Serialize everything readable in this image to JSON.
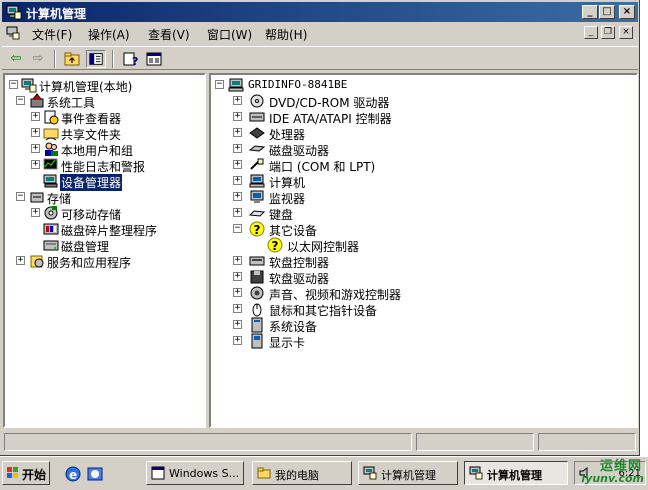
{
  "window": {
    "title": "计算机管理"
  },
  "menu": {
    "items": [
      {
        "label": "文件(F)"
      },
      {
        "label": "操作(A)"
      },
      {
        "label": "查看(V)"
      },
      {
        "label": "窗口(W)"
      },
      {
        "label": "帮助(H)"
      }
    ]
  },
  "left_tree": [
    {
      "label": "计算机管理(本地)",
      "expanded": true,
      "icon": "computer-management-icon"
    },
    {
      "label": "系统工具",
      "expanded": true,
      "icon": "system-tools-icon"
    },
    {
      "label": "事件查看器",
      "expanded": false,
      "icon": "event-viewer-icon"
    },
    {
      "label": "共享文件夹",
      "expanded": false,
      "icon": "shared-folder-icon"
    },
    {
      "label": "本地用户和组",
      "expanded": false,
      "icon": "users-icon"
    },
    {
      "label": "性能日志和警报",
      "expanded": false,
      "icon": "performance-icon"
    },
    {
      "label": "设备管理器",
      "selected": true,
      "icon": "device-manager-icon"
    },
    {
      "label": "存储",
      "expanded": true,
      "icon": "storage-icon"
    },
    {
      "label": "可移动存储",
      "expanded": false,
      "icon": "removable-storage-icon"
    },
    {
      "label": "磁盘碎片整理程序",
      "icon": "defrag-icon"
    },
    {
      "label": "磁盘管理",
      "icon": "disk-management-icon"
    },
    {
      "label": "服务和应用程序",
      "expanded": false,
      "icon": "services-icon"
    }
  ],
  "right_tree": {
    "root": "GRIDINFO-8841BE",
    "items": [
      {
        "label": "DVD/CD-ROM 驱动器",
        "icon": "dvd-icon"
      },
      {
        "label": "IDE ATA/ATAPI 控制器",
        "icon": "ide-controller-icon"
      },
      {
        "label": "处理器",
        "icon": "processor-icon"
      },
      {
        "label": "磁盘驱动器",
        "icon": "disk-drive-icon"
      },
      {
        "label": "端口 (COM 和 LPT)",
        "icon": "port-icon"
      },
      {
        "label": "计算机",
        "icon": "computer-icon"
      },
      {
        "label": "监视器",
        "icon": "monitor-icon"
      },
      {
        "label": "键盘",
        "icon": "keyboard-icon"
      },
      {
        "label": "其它设备",
        "icon": "unknown-device-icon",
        "expanded": true
      },
      {
        "label": "以太网控制器",
        "icon": "unknown-device-icon",
        "child": true
      },
      {
        "label": "软盘控制器",
        "icon": "floppy-controller-icon"
      },
      {
        "label": "软盘驱动器",
        "icon": "floppy-drive-icon"
      },
      {
        "label": "声音、视频和游戏控制器",
        "icon": "sound-icon"
      },
      {
        "label": "鼠标和其它指针设备",
        "icon": "mouse-icon"
      },
      {
        "label": "系统设备",
        "icon": "system-device-icon"
      },
      {
        "label": "显示卡",
        "icon": "display-adapter-icon"
      }
    ]
  },
  "taskbar": {
    "start": "开始",
    "buttons": [
      {
        "label": "Windows S..."
      },
      {
        "label": "我的电脑"
      },
      {
        "label": "计算机管理"
      },
      {
        "label": "计算机管理",
        "active": true
      }
    ],
    "clock": "6:21"
  },
  "watermark": {
    "line1": "运维网",
    "line2": "iyunv.com"
  }
}
